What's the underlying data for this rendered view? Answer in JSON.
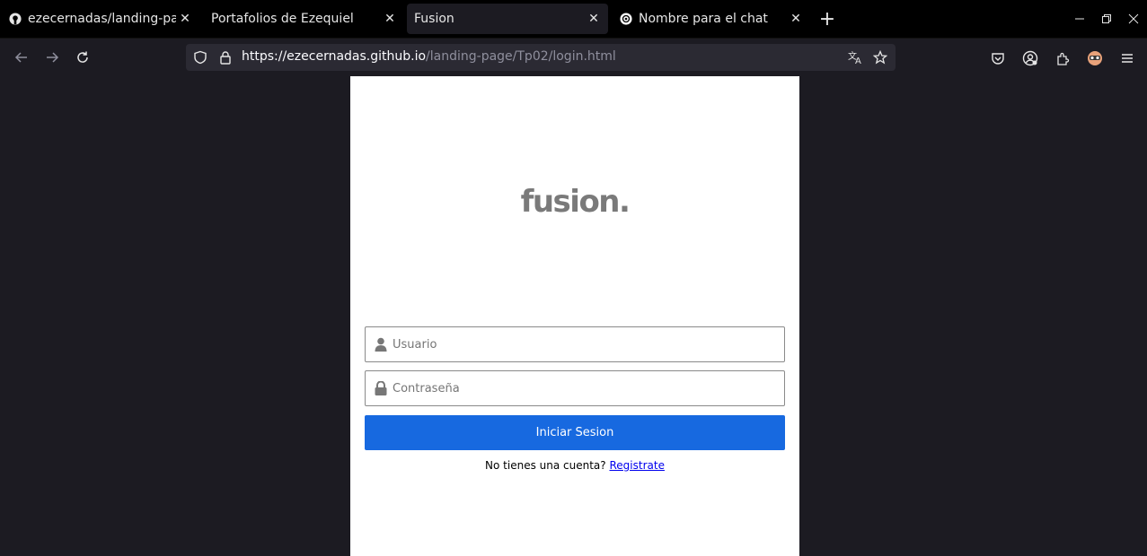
{
  "tabs": [
    {
      "title": "ezecernadas/landing-page",
      "favicon": "github-icon"
    },
    {
      "title": "Portafolios de Ezequiel",
      "favicon": ""
    },
    {
      "title": "Fusion",
      "favicon": "",
      "active": true
    },
    {
      "title": "Nombre para el chat",
      "favicon": "openai-icon"
    }
  ],
  "urlbar": {
    "domain": "https://ezecernadas.github.io",
    "path": "/landing-page/Tp02/login.html"
  },
  "page": {
    "logo": "fusion.",
    "username_placeholder": "Usuario",
    "password_placeholder": "Contraseña",
    "login_label": "Iniciar Sesion",
    "signup_prompt": "No tienes una cuenta?",
    "signup_link": "Registrate"
  },
  "colors": {
    "accent": "#1769e0",
    "logo": "#7a7a7a",
    "chrome_bg": "#1c1b22",
    "tabstrip_bg": "#000000"
  }
}
